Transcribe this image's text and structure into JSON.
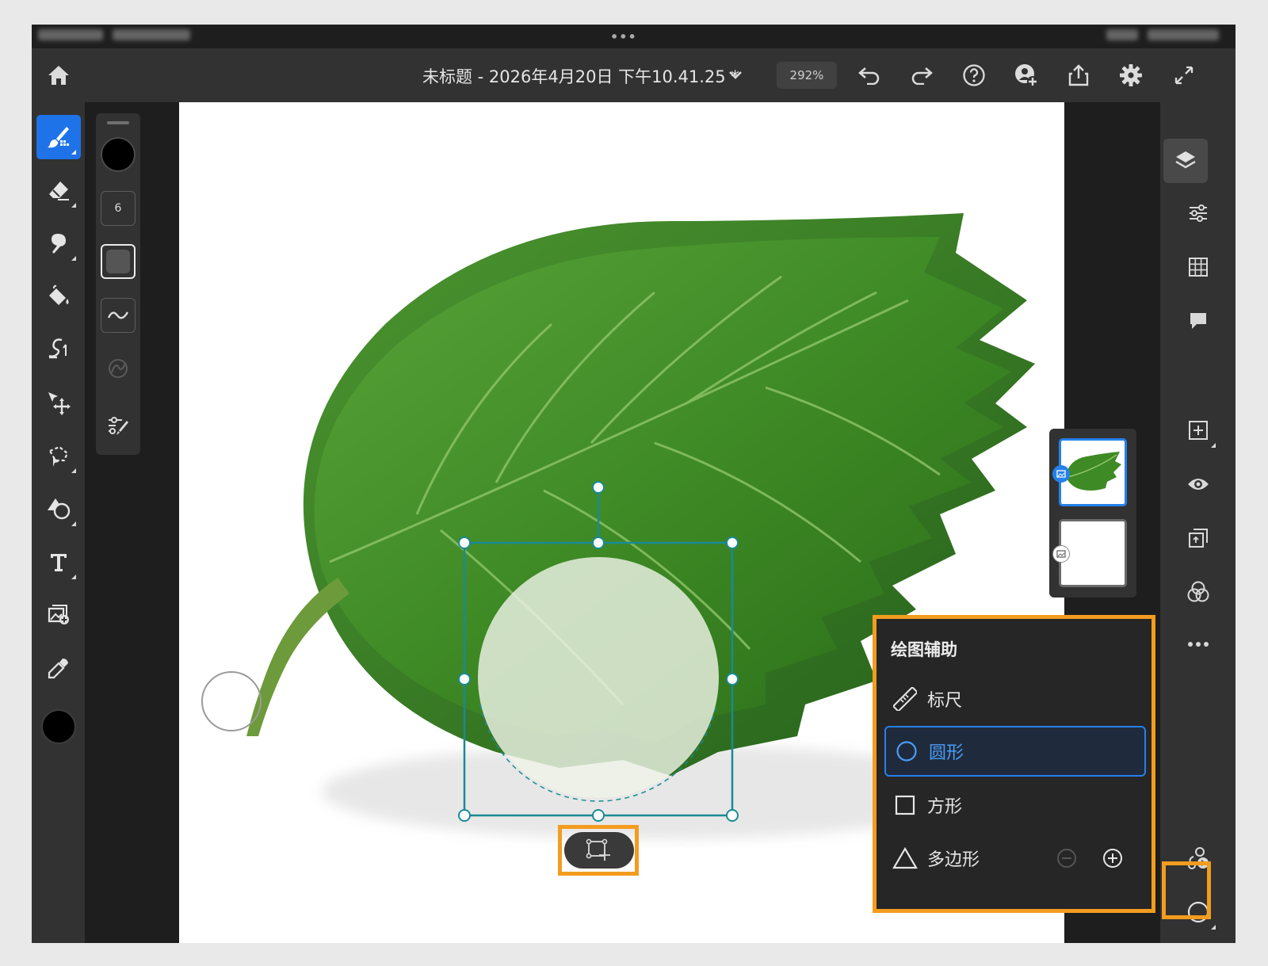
{
  "app": {
    "document_title": "未标题 - 2026年4月20日 下午10.41.25 *",
    "zoom": "292%"
  },
  "top_bar_icons": [
    "home-icon",
    "chevron-down-icon",
    "undo-icon",
    "redo-icon",
    "help-icon",
    "invite-icon",
    "share-icon",
    "settings-icon",
    "fullscreen-icon"
  ],
  "left_toolbar": {
    "tools": [
      "brush-tool",
      "eraser-tool",
      "smudge-tool",
      "fill-tool",
      "liquify-tool",
      "move-tool",
      "lasso-tool",
      "shape-tool",
      "text-tool",
      "place-image-tool",
      "eyedropper-tool"
    ],
    "active_tool": "brush-tool"
  },
  "brush_panel": {
    "size": "6",
    "color": "#000000"
  },
  "layers": {
    "count": 2,
    "selected_index": 0
  },
  "drawing_aids": {
    "title": "绘图辅助",
    "items": [
      {
        "label": "标尺",
        "icon": "ruler-icon"
      },
      {
        "label": "圆形",
        "icon": "circle-icon",
        "selected": true
      },
      {
        "label": "方形",
        "icon": "square-icon"
      },
      {
        "label": "多边形",
        "icon": "triangle-icon"
      }
    ]
  },
  "colors": {
    "accent": "#2680eb",
    "highlight": "#f39c1f",
    "panel": "#323232",
    "selection": "#1a8a94"
  }
}
